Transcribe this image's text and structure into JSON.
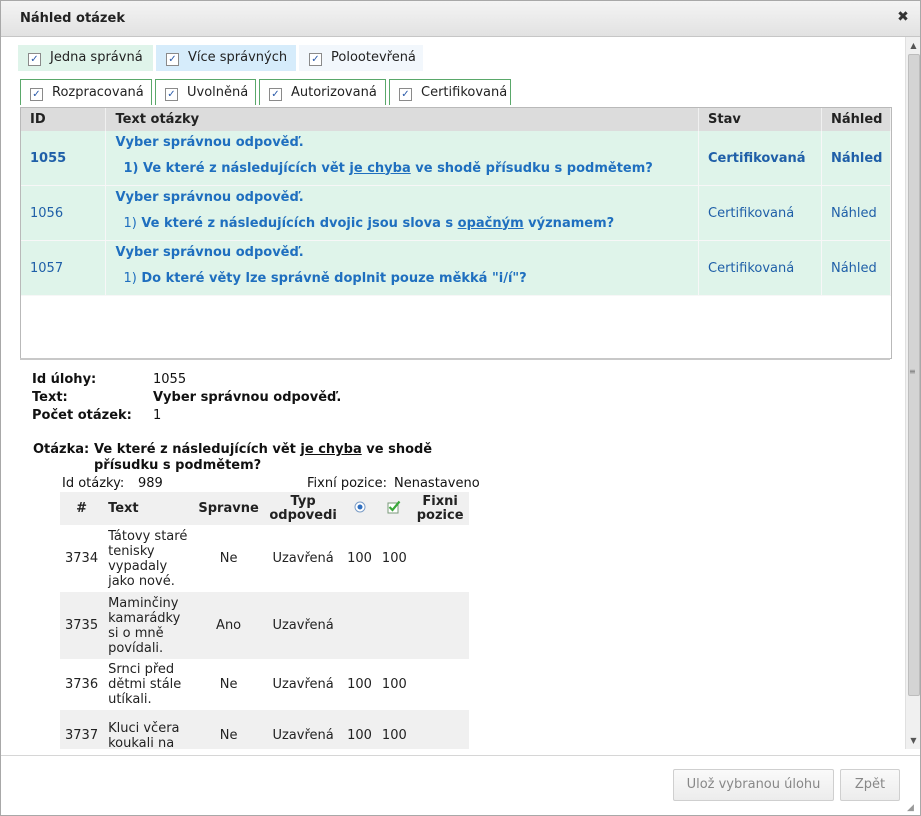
{
  "dialog": {
    "title": "Náhled otázek",
    "close_symbol": "✖"
  },
  "type_filters": [
    {
      "label": "Jedna správná",
      "checked": true,
      "bg": "#dff4ea"
    },
    {
      "label": "Více správných",
      "checked": true,
      "bg": "#d6ecfb"
    },
    {
      "label": "Polootevřená",
      "checked": true,
      "bg": "#f2f7fc"
    }
  ],
  "state_filters": [
    {
      "label": "Rozpracovaná",
      "checked": true
    },
    {
      "label": "Uvolněná",
      "checked": true
    },
    {
      "label": "Autorizovaná",
      "checked": true
    },
    {
      "label": "Certifikovaná",
      "checked": true
    }
  ],
  "question_table": {
    "headers": {
      "id": "ID",
      "text": "Text otázky",
      "state": "Stav",
      "preview": "Náhled"
    },
    "rows": [
      {
        "id": "1055",
        "title": "Vyber správnou odpověď.",
        "num": "1)",
        "q_pre": "Ve které z následujících vět",
        "q_u": "je chyba",
        "q_post": "ve shodě přísudku s podmětem?",
        "state": "Certifikovaná",
        "preview": "Náhled",
        "selected": true
      },
      {
        "id": "1056",
        "title": "Vyber správnou odpověď.",
        "num": "1)",
        "q_pre": "Ve které z následujících dvojic jsou slova s",
        "q_u": "opačným",
        "q_post": "významem?",
        "state": "Certifikovaná",
        "preview": "Náhled",
        "selected": false
      },
      {
        "id": "1057",
        "title": "Vyber správnou odpověď.",
        "num": "1)",
        "q_pre": "Do které věty lze správně doplnit pouze měkká \"i/í\"?",
        "q_u": "",
        "q_post": "",
        "state": "Certifikovaná",
        "preview": "Náhled",
        "selected": false
      }
    ]
  },
  "detail": {
    "task_id_label": "Id úlohy:",
    "task_id": "1055",
    "text_label": "Text:",
    "text": "Vyber správnou odpověď.",
    "count_label": "Počet otázek:",
    "count": "1",
    "question_label": "Otázka:",
    "question_pre": "Ve které z následujících vět",
    "question_u": "je chyba",
    "question_post_line1": "ve shodě",
    "question_line2": "přísudku s podmětem?",
    "question_id_label": "Id otázky:",
    "question_id": "989",
    "fixed_pos_label": "Fixní pozice:",
    "fixed_pos": "Nenastaveno"
  },
  "answer_table": {
    "headers": {
      "num": "#",
      "text": "Text",
      "correct": "Spravne",
      "type_l1": "Typ",
      "type_l2": "odpovedi",
      "fixed_l1": "Fixni",
      "fixed_l2": "pozice"
    },
    "header_icons": [
      "radio-icon",
      "checkmark-icon"
    ],
    "rows": [
      {
        "num": "3734",
        "text": "Tátovy staré tenisky vypadaly jako nové.",
        "correct": "Ne",
        "type": "Uzavřená",
        "v1": "100",
        "v2": "100",
        "fixed": ""
      },
      {
        "num": "3735",
        "text": "Maminčiny kamarádky si o mně povídali.",
        "correct": "Ano",
        "type": "Uzavřená",
        "v1": "",
        "v2": "",
        "fixed": ""
      },
      {
        "num": "3736",
        "text": "Srnci před dětmi stále utíkali.",
        "correct": "Ne",
        "type": "Uzavřená",
        "v1": "100",
        "v2": "100",
        "fixed": ""
      },
      {
        "num": "3737",
        "text": "Kluci včera koukali na",
        "correct": "Ne",
        "type": "Uzavřená",
        "v1": "100",
        "v2": "100",
        "fixed": ""
      }
    ]
  },
  "footer": {
    "save_label": "Ulož vybranou úlohu",
    "back_label": "Zpět"
  },
  "colors": {
    "row_bg": "#dff4ea",
    "link": "#1f5fa8",
    "tab_border": "#5aa86a"
  }
}
